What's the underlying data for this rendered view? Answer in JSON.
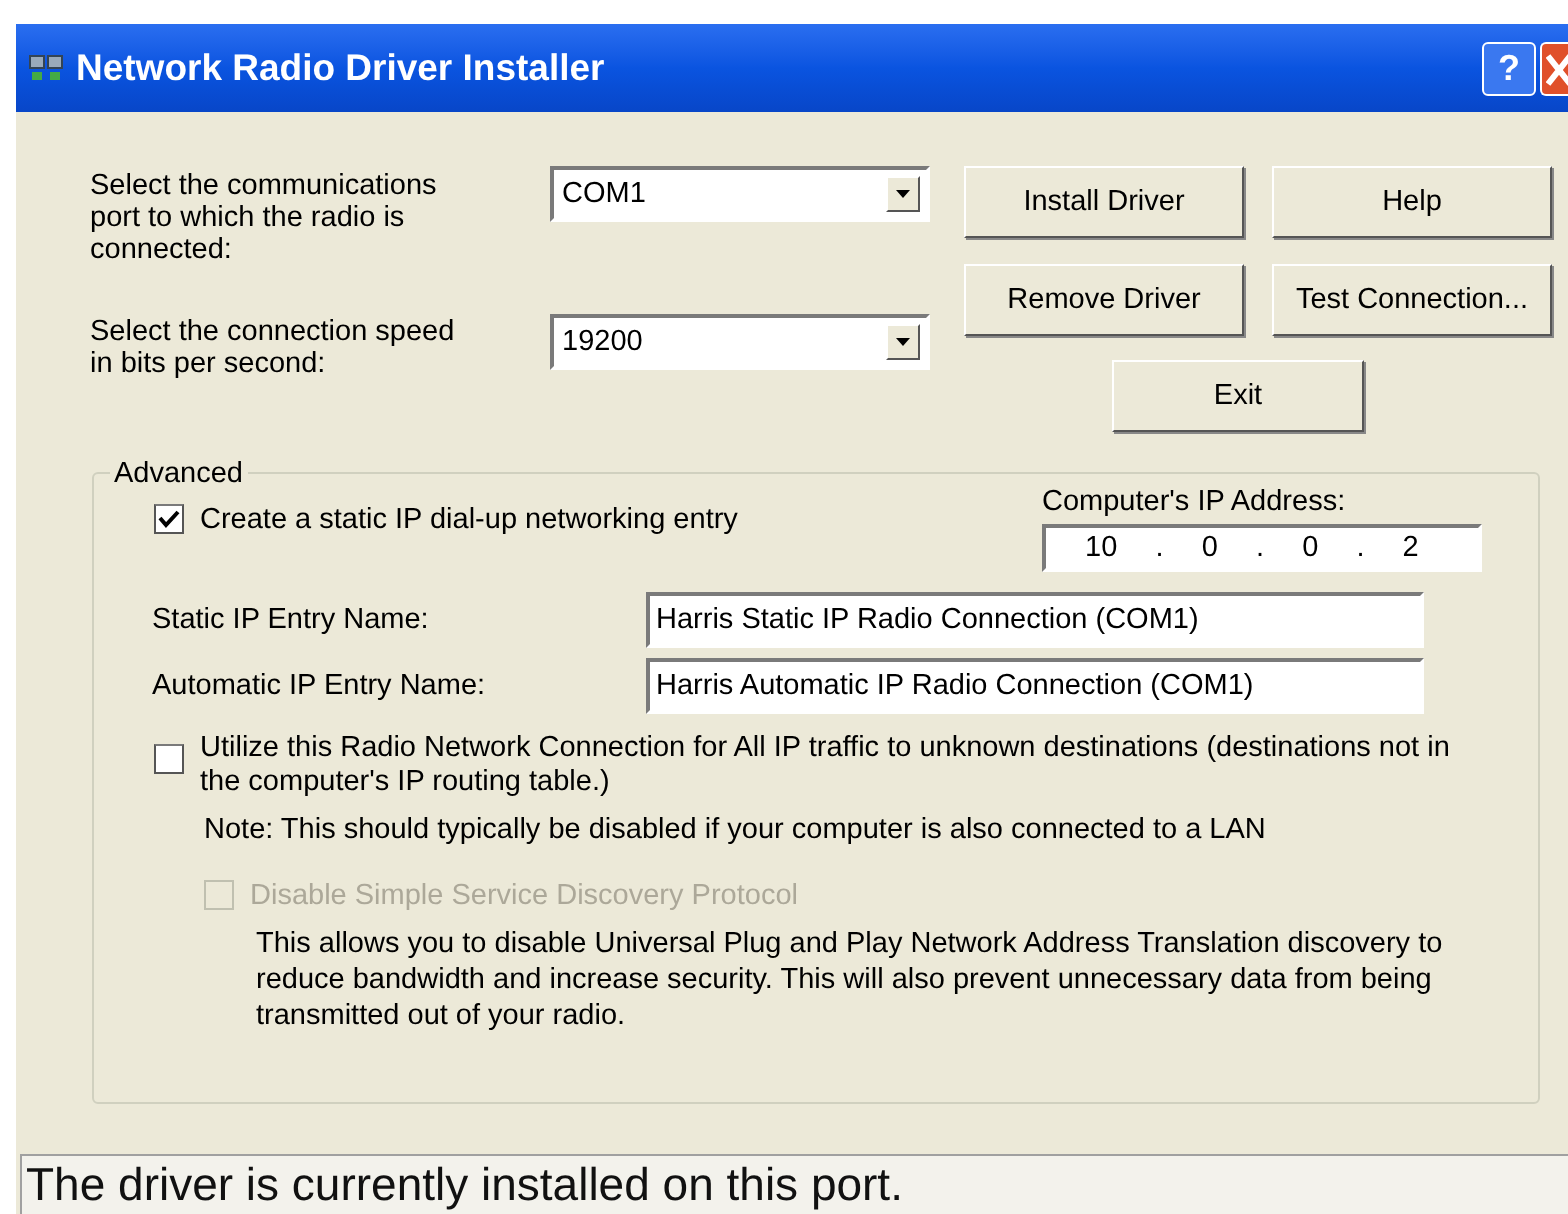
{
  "window": {
    "title": "Network Radio Driver Installer",
    "help_glyph": "?"
  },
  "port": {
    "label": "Select the communications port to which the radio is connected:",
    "value": "COM1"
  },
  "speed": {
    "label": "Select the connection speed in bits per second:",
    "value": "19200"
  },
  "buttons": [
    "Install Driver",
    "Help",
    "Remove Driver",
    "Test Connection...",
    "Exit"
  ],
  "advanced": {
    "title": "Advanced",
    "static_entry": {
      "label": "Create a static IP dial-up networking entry",
      "checked": true,
      "disabled": false
    },
    "ip_address": {
      "label": "Computer's IP Address:",
      "octets": [
        "10",
        "0",
        "0",
        "2"
      ],
      "separator": "."
    },
    "fields": [
      {
        "label": "Static IP Entry Name:",
        "value": "Harris Static IP Radio Connection (COM1)"
      },
      {
        "label": "Automatic IP Entry Name:",
        "value": "Harris Automatic IP Radio Connection (COM1)"
      }
    ],
    "default_route": {
      "label": "Utilize this Radio Network Connection for All IP traffic to unknown destinations (destinations not in the computer's IP routing table.)",
      "checked": false,
      "disabled": false
    },
    "note": "Note: This should typically be disabled if your computer is also connected to a LAN",
    "ssdp": {
      "label": "Disable Simple Service Discovery Protocol",
      "checked": false,
      "disabled": true
    },
    "ssdp_description": "This allows you to disable Universal Plug and Play Network Address Translation discovery to reduce bandwidth and increase security.  This will also prevent unnecessary data from being transmitted out of your radio."
  },
  "status_bar": "The driver is currently installed on this port."
}
